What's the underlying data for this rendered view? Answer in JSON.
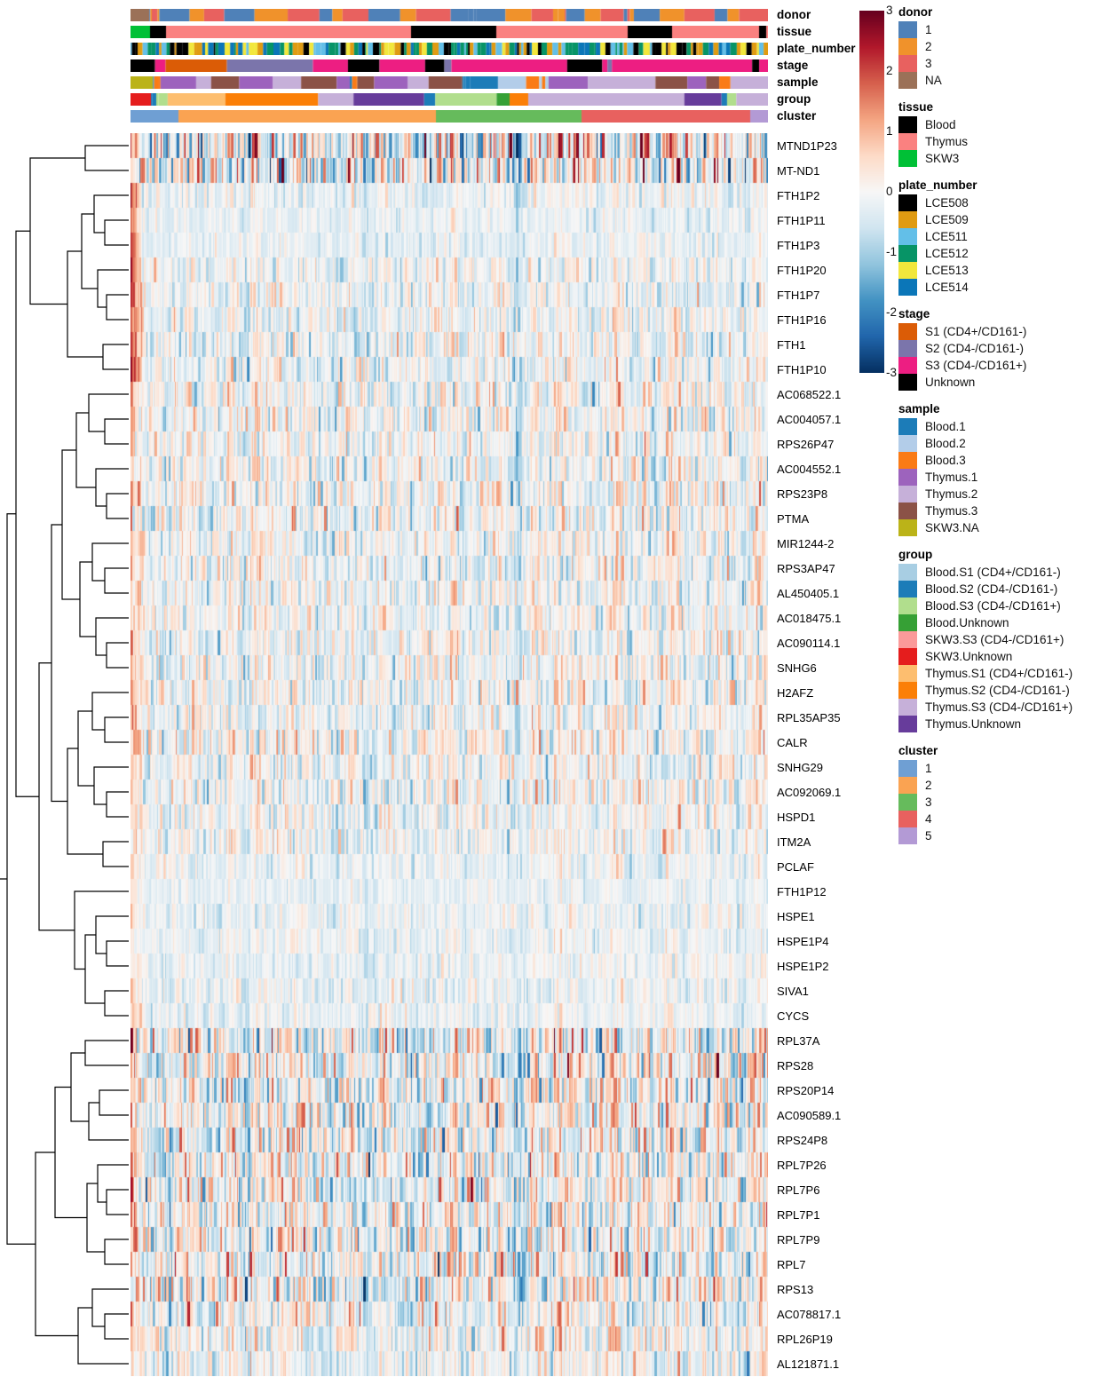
{
  "colorbar": {
    "ticks": [
      "3",
      "2",
      "1",
      "0",
      "-1",
      "-2",
      "-3"
    ],
    "vmin": -3,
    "vmax": 3,
    "low_color": "#053061",
    "mid_color": "#ffffff",
    "high_color": "#67001f"
  },
  "annotation_rows": [
    {
      "name": "donor",
      "label": "donor"
    },
    {
      "name": "tissue",
      "label": "tissue"
    },
    {
      "name": "plate_number",
      "label": "plate_number"
    },
    {
      "name": "stage",
      "label": "stage"
    },
    {
      "name": "sample",
      "label": "sample"
    },
    {
      "name": "group",
      "label": "group"
    },
    {
      "name": "cluster",
      "label": "cluster"
    }
  ],
  "legends": [
    {
      "title": "donor",
      "items": [
        {
          "label": "1",
          "color": "#4f81b8"
        },
        {
          "label": "2",
          "color": "#f0922b"
        },
        {
          "label": "3",
          "color": "#e8615f"
        },
        {
          "label": "NA",
          "color": "#9b7158"
        }
      ]
    },
    {
      "title": "tissue",
      "items": [
        {
          "label": "Blood",
          "color": "#000000"
        },
        {
          "label": "Thymus",
          "color": "#fa8180"
        },
        {
          "label": "SKW3",
          "color": "#00c036"
        }
      ]
    },
    {
      "title": "plate_number",
      "items": [
        {
          "label": "LCE508",
          "color": "#000000"
        },
        {
          "label": "LCE509",
          "color": "#e09b12"
        },
        {
          "label": "LCE511",
          "color": "#63bfe8"
        },
        {
          "label": "LCE512",
          "color": "#079466"
        },
        {
          "label": "LCE513",
          "color": "#f2e73c"
        },
        {
          "label": "LCE514",
          "color": "#0b76b8"
        }
      ]
    },
    {
      "title": "stage",
      "items": [
        {
          "label": "S1 (CD4+/CD161-)",
          "color": "#db5c06"
        },
        {
          "label": "S2 (CD4-/CD161-)",
          "color": "#7b75ab"
        },
        {
          "label": "S3 (CD4-/CD161+)",
          "color": "#ed1e82"
        },
        {
          "label": "Unknown",
          "color": "#000000"
        }
      ]
    },
    {
      "title": "sample",
      "items": [
        {
          "label": "Blood.1",
          "color": "#1c7cb8"
        },
        {
          "label": "Blood.2",
          "color": "#b3cde9"
        },
        {
          "label": "Blood.3",
          "color": "#fa7b16"
        },
        {
          "label": "Thymus.1",
          "color": "#9d63bd"
        },
        {
          "label": "Thymus.2",
          "color": "#c6b0d9"
        },
        {
          "label": "Thymus.3",
          "color": "#8b5247"
        },
        {
          "label": "SKW3.NA",
          "color": "#bbb318"
        }
      ]
    },
    {
      "title": "group",
      "items": [
        {
          "label": "Blood.S1 (CD4+/CD161-)",
          "color": "#a8cee3"
        },
        {
          "label": "Blood.S2 (CD4-/CD161-)",
          "color": "#1c7cb8"
        },
        {
          "label": "Blood.S3 (CD4-/CD161+)",
          "color": "#b1de8d"
        },
        {
          "label": "Blood.Unknown",
          "color": "#36a035"
        },
        {
          "label": "SKW3.S3 (CD4-/CD161+)",
          "color": "#fb9a9a"
        },
        {
          "label": "SKW3.Unknown",
          "color": "#e51d1d"
        },
        {
          "label": "Thymus.S1 (CD4+/CD161-)",
          "color": "#fdbe6f"
        },
        {
          "label": "Thymus.S2 (CD4-/CD161-)",
          "color": "#fb7f07"
        },
        {
          "label": "Thymus.S3 (CD4-/CD161+)",
          "color": "#c6b0d9"
        },
        {
          "label": "Thymus.Unknown",
          "color": "#673c9b"
        }
      ]
    },
    {
      "title": "cluster",
      "items": [
        {
          "label": "1",
          "color": "#6f9fd3"
        },
        {
          "label": "2",
          "color": "#faa352"
        },
        {
          "label": "3",
          "color": "#66bb5c"
        },
        {
          "label": "4",
          "color": "#e8615f"
        },
        {
          "label": "5",
          "color": "#b39ad5"
        }
      ]
    }
  ],
  "genes": [
    "MTND1P23",
    "MT-ND1",
    "FTH1P2",
    "FTH1P11",
    "FTH1P3",
    "FTH1P20",
    "FTH1P7",
    "FTH1P16",
    "FTH1",
    "FTH1P10",
    "AC068522.1",
    "AC004057.1",
    "RPS26P47",
    "AC004552.1",
    "RPS23P8",
    "PTMA",
    "MIR1244-2",
    "RPS3AP47",
    "AL450405.1",
    "AC018475.1",
    "AC090114.1",
    "SNHG6",
    "H2AFZ",
    "RPL35AP35",
    "CALR",
    "SNHG29",
    "AC092069.1",
    "HSPD1",
    "ITM2A",
    "PCLAF",
    "FTH1P12",
    "HSPE1",
    "HSPE1P4",
    "HSPE1P2",
    "SIVA1",
    "CYCS",
    "RPL37A",
    "RPS28",
    "RPS20P14",
    "AC090589.1",
    "RPS24P8",
    "RPL7P26",
    "RPL7P6",
    "RPL7P1",
    "RPL7P9",
    "RPL7",
    "RPS13",
    "AC078817.1",
    "RPL26P19",
    "AL121871.1"
  ],
  "chart_data": {
    "type": "heatmap",
    "title": "",
    "xlabel": "",
    "ylabel": "",
    "value_range": [
      -3,
      3
    ],
    "n_rows": 50,
    "n_columns": 718,
    "row_labels": [
      "MTND1P23",
      "MT-ND1",
      "FTH1P2",
      "FTH1P11",
      "FTH1P3",
      "FTH1P20",
      "FTH1P7",
      "FTH1P16",
      "FTH1",
      "FTH1P10",
      "AC068522.1",
      "AC004057.1",
      "RPS26P47",
      "AC004552.1",
      "RPS23P8",
      "PTMA",
      "MIR1244-2",
      "RPS3AP47",
      "AL450405.1",
      "AC018475.1",
      "AC090114.1",
      "SNHG6",
      "H2AFZ",
      "RPL35AP35",
      "CALR",
      "SNHG29",
      "AC092069.1",
      "HSPD1",
      "ITM2A",
      "PCLAF",
      "FTH1P12",
      "HSPE1",
      "HSPE1P4",
      "HSPE1P2",
      "SIVA1",
      "CYCS",
      "RPL37A",
      "RPS28",
      "RPS20P14",
      "AC090589.1",
      "RPS24P8",
      "RPL7P26",
      "RPL7P6",
      "RPL7P1",
      "RPL7P9",
      "RPL7",
      "RPS13",
      "AC078817.1",
      "RPL26P19",
      "AL121871.1"
    ],
    "row_profiles": [
      {
        "gene": "MTND1P23",
        "mean": 0.05,
        "sd": 1.15,
        "left_block": 1.2
      },
      {
        "gene": "MT-ND1",
        "mean": 0.0,
        "sd": 1.1,
        "left_block": 1.2
      },
      {
        "gene": "FTH1P2",
        "mean": -0.18,
        "sd": 0.35,
        "left_block": 2.0
      },
      {
        "gene": "FTH1P11",
        "mean": -0.2,
        "sd": 0.28,
        "left_block": 2.0
      },
      {
        "gene": "FTH1P3",
        "mean": -0.2,
        "sd": 0.28,
        "left_block": 2.0
      },
      {
        "gene": "FTH1P20",
        "mean": -0.12,
        "sd": 0.45,
        "left_block": 2.4
      },
      {
        "gene": "FTH1P7",
        "mean": -0.12,
        "sd": 0.45,
        "left_block": 2.4
      },
      {
        "gene": "FTH1P16",
        "mean": -0.12,
        "sd": 0.45,
        "left_block": 2.4
      },
      {
        "gene": "FTH1",
        "mean": -0.1,
        "sd": 0.55,
        "left_block": 2.6
      },
      {
        "gene": "FTH1P10",
        "mean": -0.1,
        "sd": 0.5,
        "left_block": 2.6
      },
      {
        "gene": "AC068522.1",
        "mean": -0.05,
        "sd": 0.55,
        "left_block": 0.9
      },
      {
        "gene": "AC004057.1",
        "mean": -0.05,
        "sd": 0.55,
        "left_block": 0.9
      },
      {
        "gene": "RPS26P47",
        "mean": -0.05,
        "sd": 0.55,
        "left_block": 0.9
      },
      {
        "gene": "AC004552.1",
        "mean": -0.05,
        "sd": 0.55,
        "left_block": 0.9
      },
      {
        "gene": "RPS23P8",
        "mean": -0.05,
        "sd": 0.58,
        "left_block": 0.9
      },
      {
        "gene": "PTMA",
        "mean": -0.05,
        "sd": 0.58,
        "left_block": 0.9
      },
      {
        "gene": "MIR1244-2",
        "mean": -0.05,
        "sd": 0.5,
        "left_block": 1.1
      },
      {
        "gene": "RPS3AP47",
        "mean": -0.05,
        "sd": 0.58,
        "left_block": 0.9
      },
      {
        "gene": "AL450405.1",
        "mean": -0.05,
        "sd": 0.5,
        "left_block": 0.9
      },
      {
        "gene": "AC018475.1",
        "mean": -0.05,
        "sd": 0.5,
        "left_block": 0.9
      },
      {
        "gene": "AC090114.1",
        "mean": -0.05,
        "sd": 0.52,
        "left_block": 0.9
      },
      {
        "gene": "SNHG6",
        "mean": -0.05,
        "sd": 0.52,
        "left_block": 0.9
      },
      {
        "gene": "H2AFZ",
        "mean": -0.05,
        "sd": 0.55,
        "left_block": 1.0
      },
      {
        "gene": "RPL35AP35",
        "mean": -0.05,
        "sd": 0.5,
        "left_block": 0.9
      },
      {
        "gene": "CALR",
        "mean": -0.05,
        "sd": 0.58,
        "left_block": 1.2
      },
      {
        "gene": "SNHG29",
        "mean": -0.05,
        "sd": 0.5,
        "left_block": 0.9
      },
      {
        "gene": "AC092069.1",
        "mean": -0.05,
        "sd": 0.55,
        "left_block": 1.1
      },
      {
        "gene": "HSPD1",
        "mean": -0.08,
        "sd": 0.45,
        "left_block": 1.0
      },
      {
        "gene": "ITM2A",
        "mean": -0.08,
        "sd": 0.45,
        "left_block": 0.9
      },
      {
        "gene": "PCLAF",
        "mean": -0.15,
        "sd": 0.35,
        "left_block": 0.9
      },
      {
        "gene": "FTH1P12",
        "mean": -0.2,
        "sd": 0.25,
        "left_block": 0.7
      },
      {
        "gene": "HSPE1",
        "mean": -0.15,
        "sd": 0.32,
        "left_block": 0.8
      },
      {
        "gene": "HSPE1P4",
        "mean": -0.15,
        "sd": 0.32,
        "left_block": 0.8
      },
      {
        "gene": "HSPE1P2",
        "mean": -0.15,
        "sd": 0.3,
        "left_block": 0.8
      },
      {
        "gene": "SIVA1",
        "mean": -0.15,
        "sd": 0.33,
        "left_block": 0.9
      },
      {
        "gene": "CYCS",
        "mean": -0.15,
        "sd": 0.33,
        "left_block": 0.9
      },
      {
        "gene": "RPL37A",
        "mean": -0.02,
        "sd": 0.85,
        "left_block": 1.0
      },
      {
        "gene": "RPS28",
        "mean": -0.02,
        "sd": 0.8,
        "left_block": 1.2
      },
      {
        "gene": "RPS20P14",
        "mean": -0.02,
        "sd": 0.75,
        "left_block": 1.0
      },
      {
        "gene": "AC090589.1",
        "mean": -0.02,
        "sd": 0.78,
        "left_block": 1.0
      },
      {
        "gene": "RPS24P8",
        "mean": -0.02,
        "sd": 0.8,
        "left_block": 1.0
      },
      {
        "gene": "RPL7P26",
        "mean": -0.02,
        "sd": 0.78,
        "left_block": 1.0
      },
      {
        "gene": "RPL7P6",
        "mean": -0.02,
        "sd": 0.78,
        "left_block": 1.0
      },
      {
        "gene": "RPL7P1",
        "mean": -0.02,
        "sd": 0.8,
        "left_block": 1.0
      },
      {
        "gene": "RPL7P9",
        "mean": -0.02,
        "sd": 0.8,
        "left_block": 1.0
      },
      {
        "gene": "RPL7",
        "mean": -0.02,
        "sd": 0.8,
        "left_block": 1.0
      },
      {
        "gene": "RPS13",
        "mean": -0.02,
        "sd": 0.82,
        "left_block": 1.0
      },
      {
        "gene": "AC078817.1",
        "mean": -0.05,
        "sd": 0.65,
        "left_block": 1.0
      },
      {
        "gene": "RPL26P19",
        "mean": -0.05,
        "sd": 0.6,
        "left_block": 1.1
      },
      {
        "gene": "AL121871.1",
        "mean": -0.08,
        "sd": 0.55,
        "left_block": 1.1
      }
    ]
  }
}
